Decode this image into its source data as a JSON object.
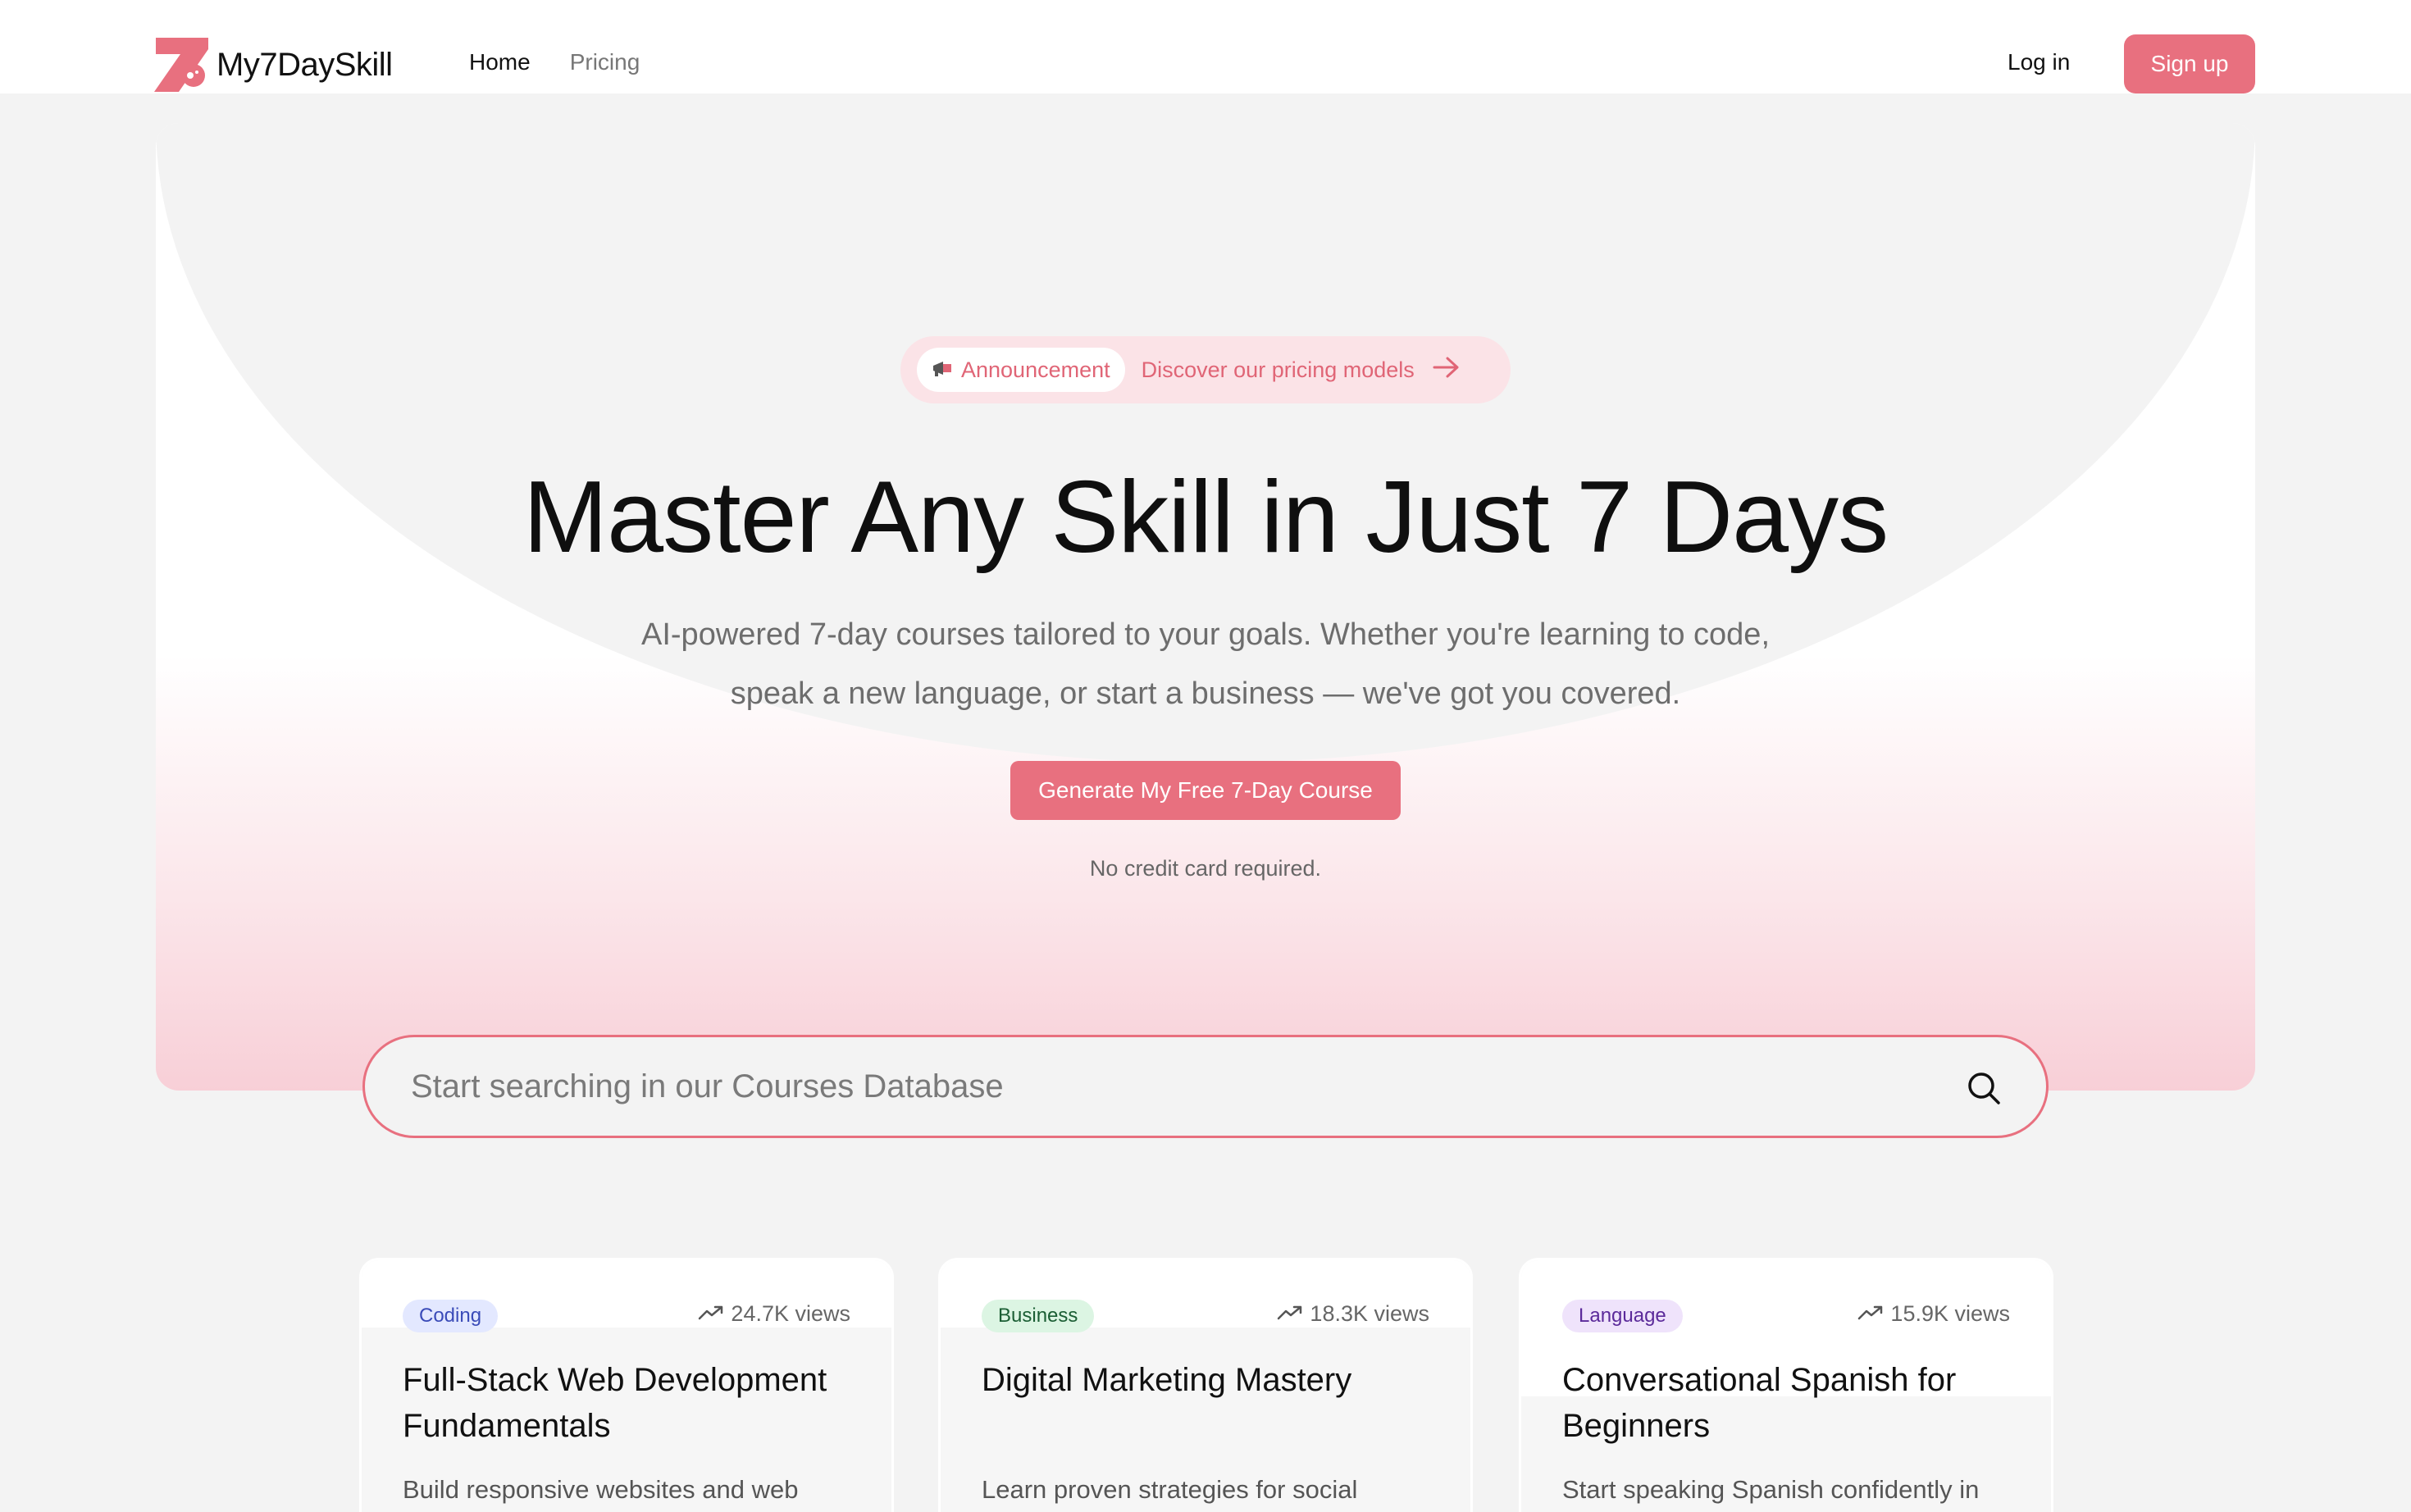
{
  "header": {
    "brand": "My7DaySkill",
    "nav": [
      {
        "label": "Home"
      },
      {
        "label": "Pricing"
      }
    ],
    "login_label": "Log in",
    "signup_label": "Sign up"
  },
  "hero": {
    "announcement_label": "Announcement",
    "announcement_link": "Discover our pricing models",
    "title": "Master Any Skill in Just 7 Days",
    "subtitle": "AI-powered 7-day courses tailored to your goals. Whether you're learning to code, speak a new language, or start a business — we've got you covered.",
    "cta_label": "Generate My Free 7-Day Course",
    "note": "No credit card required."
  },
  "search": {
    "placeholder": "Start searching in our Courses Database"
  },
  "courses": [
    {
      "category": "Coding",
      "views": "24.7K views",
      "title": "Full-Stack Web Development Fundamentals",
      "description": "Build responsive websites and web"
    },
    {
      "category": "Business",
      "views": "18.3K views",
      "title": "Digital Marketing Mastery",
      "description": "Learn proven strategies for social"
    },
    {
      "category": "Language",
      "views": "15.9K views",
      "title": "Conversational Spanish for Beginners",
      "description": "Start speaking Spanish confidently in"
    }
  ],
  "colors": {
    "accent": "#e8707f",
    "coding_badge_bg": "#e3e8ff",
    "coding_badge_text": "#3a4bb8",
    "business_badge_bg": "#dcf5e3",
    "business_badge_text": "#1b5e34",
    "language_badge_bg": "#efe3fb",
    "language_badge_text": "#5b2a9a"
  }
}
